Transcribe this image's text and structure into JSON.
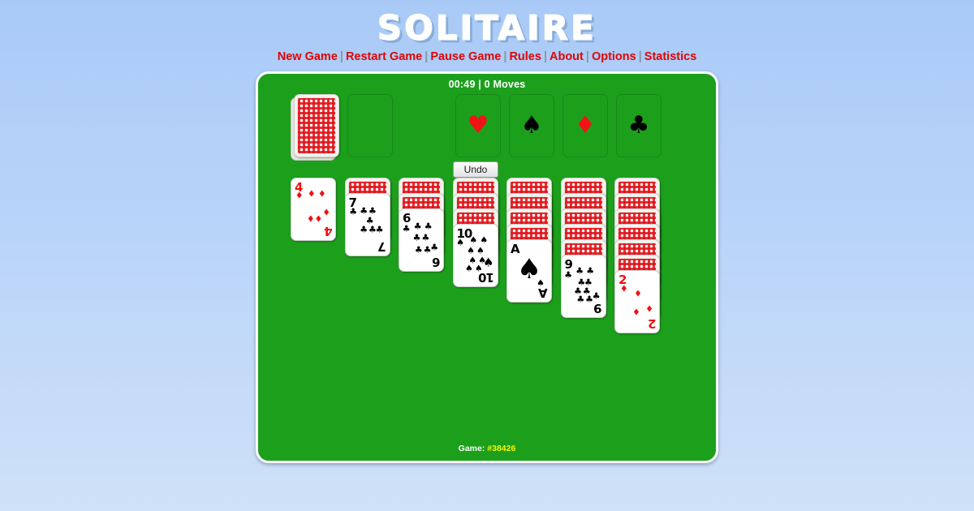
{
  "header": {
    "title": "SOLITAIRE",
    "separator": "|",
    "nav": [
      {
        "label": "New Game",
        "name": "nav-new-game"
      },
      {
        "label": "Restart Game",
        "name": "nav-restart-game"
      },
      {
        "label": "Pause Game",
        "name": "nav-pause-game"
      },
      {
        "label": "Rules",
        "name": "nav-rules"
      },
      {
        "label": "About",
        "name": "nav-about"
      },
      {
        "label": "Options",
        "name": "nav-options"
      },
      {
        "label": "Statistics",
        "name": "nav-statistics"
      }
    ]
  },
  "status": {
    "time": "00:49",
    "moves": "0 Moves",
    "text": "00:49 | 0 Moves"
  },
  "footer": {
    "label": "Game:",
    "game_id": "#38426"
  },
  "controls": {
    "undo_label": "Undo"
  },
  "foundations": [
    {
      "suit": "hearts",
      "symbol": "♥",
      "color": "red",
      "name": "foundation-hearts"
    },
    {
      "suit": "spades",
      "symbol": "♠",
      "color": "black",
      "name": "foundation-spades"
    },
    {
      "suit": "diamonds",
      "symbol": "♦",
      "color": "red",
      "name": "foundation-diamonds"
    },
    {
      "suit": "clubs",
      "symbol": "♣",
      "color": "black",
      "name": "foundation-clubs"
    }
  ],
  "stock": {
    "face_down": true,
    "count": 24,
    "name": "stock-pile"
  },
  "waste": {
    "empty": true,
    "name": "waste-pile"
  },
  "tableau": [
    {
      "column": 1,
      "face_down": 0,
      "face_up": [
        {
          "rank": "4",
          "suit": "diamonds",
          "symbol": "♦",
          "color": "red"
        }
      ]
    },
    {
      "column": 2,
      "face_down": 1,
      "face_up": [
        {
          "rank": "7",
          "suit": "clubs",
          "symbol": "♣",
          "color": "black"
        }
      ]
    },
    {
      "column": 3,
      "face_down": 2,
      "face_up": [
        {
          "rank": "6",
          "suit": "clubs",
          "symbol": "♣",
          "color": "black"
        }
      ]
    },
    {
      "column": 4,
      "face_down": 3,
      "face_up": [
        {
          "rank": "10",
          "suit": "spades",
          "symbol": "♠",
          "color": "black"
        }
      ]
    },
    {
      "column": 5,
      "face_down": 4,
      "face_up": [
        {
          "rank": "A",
          "suit": "spades",
          "symbol": "♠",
          "color": "black"
        }
      ]
    },
    {
      "column": 6,
      "face_down": 5,
      "face_up": [
        {
          "rank": "9",
          "suit": "clubs",
          "symbol": "♣",
          "color": "black"
        }
      ]
    },
    {
      "column": 7,
      "face_down": 6,
      "face_up": [
        {
          "rank": "2",
          "suit": "diamonds",
          "symbol": "♦",
          "color": "red"
        }
      ]
    }
  ],
  "colors": {
    "table_green": "#1ca01c",
    "nav_red": "#e00505",
    "game_id_yellow": "#f5f500",
    "card_back_red": "#e11419",
    "background_top": "#a9caf7",
    "background_bottom": "#cfe1f8"
  }
}
